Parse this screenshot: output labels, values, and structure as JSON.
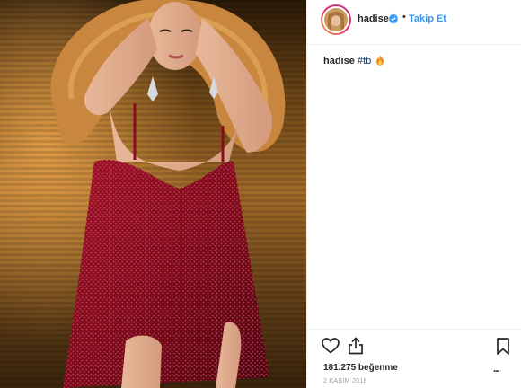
{
  "post": {
    "image_alt": "Performer in red sequin dress on stage with hands in hair",
    "author": {
      "username": "hadise",
      "verified": true,
      "follow_label": "Takip Et",
      "separator": "•"
    },
    "caption": {
      "username": "hadise",
      "hashtag": "#tb",
      "emoji_icon": "fire-emoji-icon"
    },
    "actions": {
      "like_icon": "heart-icon",
      "share_icon": "share-icon",
      "save_icon": "bookmark-icon",
      "more_label": "..."
    },
    "likes_text": "181.275 beğenme",
    "date_text": "2 KASIM 2018"
  },
  "colors": {
    "accent": "#3897f0",
    "verified": "#3897f0",
    "text": "#262626",
    "muted": "#999999"
  }
}
